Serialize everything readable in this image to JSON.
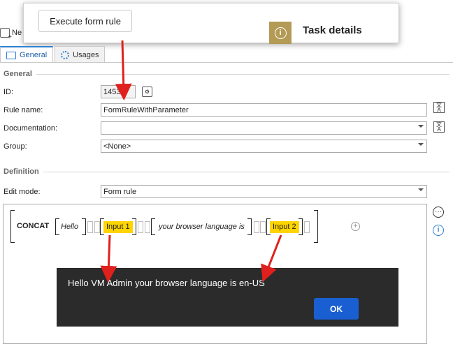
{
  "toolbar": {
    "new_label": "Ne"
  },
  "popup": {
    "execute_label": "Execute form rule",
    "task_details_label": "Task details"
  },
  "tabs": [
    {
      "label": "General"
    },
    {
      "label": "Usages"
    }
  ],
  "general": {
    "section_title": "General",
    "id_label": "ID:",
    "id_value": "1453",
    "rule_name_label": "Rule name:",
    "rule_name_value": "FormRuleWithParameter",
    "documentation_label": "Documentation:",
    "documentation_value": "",
    "group_label": "Group:",
    "group_value": "<None>"
  },
  "definition": {
    "section_title": "Definition",
    "edit_mode_label": "Edit mode:",
    "edit_mode_value": "Form rule",
    "expression": {
      "function": "CONCAT",
      "parts": [
        "Hello",
        "Input 1",
        "your browser language is",
        "Input 2"
      ]
    }
  },
  "dialog": {
    "message": "Hello VM Admin your browser language is en-US",
    "ok_label": "OK"
  },
  "colors": {
    "accent": "#2f7fd1",
    "input_highlight": "#ffd400",
    "dialog_bg": "#2b2b2b",
    "ok_button": "#1a5fd1",
    "arrow": "#e0201c",
    "task_icon": "#b39a55"
  },
  "icons": [
    "new-icon",
    "info-icon",
    "form-tab-icon",
    "gear-icon",
    "translate-icon",
    "config-icon",
    "more-icon",
    "add-icon"
  ]
}
